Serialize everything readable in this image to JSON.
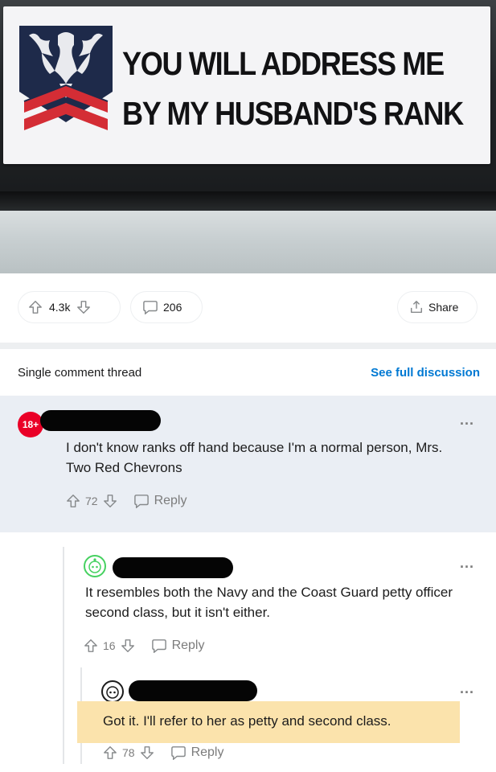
{
  "photo": {
    "sticker_line1": "YOU WILL ADDRESS ME",
    "sticker_line2": "BY MY HUSBAND'S RANK",
    "insignia_icon": "eagle-chevrons-icon",
    "colors": {
      "chevron": "#d42d35",
      "patch": "#1e2a4a"
    }
  },
  "post_actions": {
    "upvotes": "4.3k",
    "comments": "206",
    "share_label": "Share"
  },
  "thread": {
    "title": "Single comment thread",
    "see_full": "See full discussion"
  },
  "comments": [
    {
      "avatar_badge": "18+",
      "text": "I don't know ranks off hand because I'm a normal person, Mrs. Two Red Chevrons",
      "votes": "72",
      "reply_label": "Reply"
    },
    {
      "text": "It resembles both the Navy and the Coast Guard petty officer second class, but it isn't either.",
      "votes": "16",
      "reply_label": "Reply"
    },
    {
      "text": "Got it. I'll refer to her as petty and second class.",
      "votes": "78",
      "reply_label": "Reply"
    }
  ],
  "more_label": "...",
  "accent_colors": {
    "link": "#0079d3",
    "highlight": "#fbe3ac",
    "badge": "#ea0027"
  }
}
